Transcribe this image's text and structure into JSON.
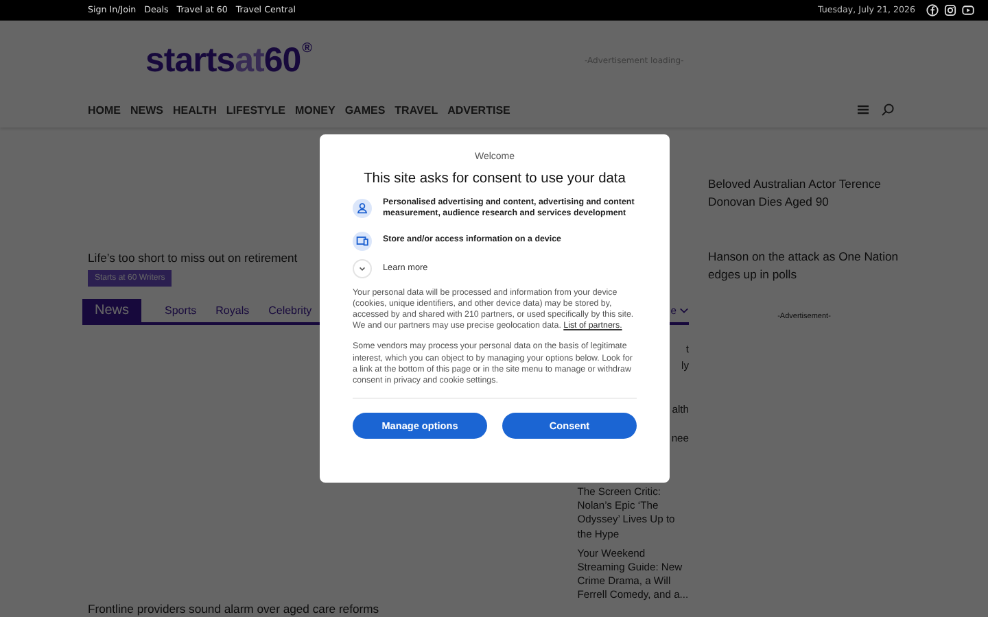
{
  "top_bar": {
    "links": [
      "Sign In/Join",
      "Deals",
      "Travel at 60",
      "Travel Central"
    ],
    "date": "Tuesday, July 21, 2026"
  },
  "header": {
    "logo": {
      "parts": [
        "starts",
        "at",
        "60"
      ],
      "mark": "®"
    },
    "ad_notice": "-Advertisement loading-"
  },
  "nav": {
    "items": [
      "HOME",
      "NEWS",
      "HEALTH",
      "LIFESTYLE",
      "MONEY",
      "GAMES",
      "TRAVEL",
      "ADVERTISE"
    ]
  },
  "promo": {
    "headline": "Life’s too short to miss out on retirement",
    "tag": "Starts at 60 Writers"
  },
  "news_tabs": [
    {
      "label": "News",
      "selected": true
    },
    {
      "label": "Sports",
      "selected": false
    },
    {
      "label": "Royals",
      "selected": false
    },
    {
      "label": "Celebrity",
      "selected": false
    }
  ],
  "more_tab": "e",
  "middle_list": [
    {
      "text": "t",
      "kind": "fragment"
    },
    {
      "text": "ly",
      "kind": "fragment"
    },
    {
      "text": "alth",
      "kind": "fragment"
    },
    {
      "text": "nee",
      "kind": "fragment"
    },
    {
      "text": "The Screen Critic: Nolan’s Epic ‘The Odyssey’ Lives Up to the Hype",
      "kind": "story"
    },
    {
      "text": "Your Weekend Streaming Guide: New Crime Drama, a Will Ferrell Comedy, and a...",
      "kind": "story"
    }
  ],
  "bottom_story": "Frontline providers sound alarm over aged care reforms",
  "sidebar": {
    "stories": [
      "Beloved Australian Actor Terence Donovan Dies Aged 90",
      "Hanson on the attack as One Nation edges up in polls"
    ],
    "ad_label": "-Advertisement-"
  },
  "consent": {
    "welcome": "Welcome",
    "title": "This site asks for consent to use your data",
    "purposes": [
      {
        "kind": "person",
        "text": "Personalised advertising and content, advertising and content measurement, audience research and services development"
      },
      {
        "kind": "device",
        "text": "Store and/or access information on a device"
      }
    ],
    "learn_more": "Learn more",
    "paragraphs": [
      "Your personal data will be processed and information from your device (cookies, unique identifiers, and other device data) may be stored by, accessed by and shared with 210 partners, or used specifically by this site. We and our partners may use precise geolocation data.",
      "Some vendors may process your personal data on the basis of legitimate interest, which you can object to by managing your options below. Look for a link at the bottom of this page or in the site menu to manage or withdraw consent in privacy and cookie settings."
    ],
    "partners_link": "List of partners.",
    "buttons": [
      "Manage options",
      "Consent"
    ]
  }
}
